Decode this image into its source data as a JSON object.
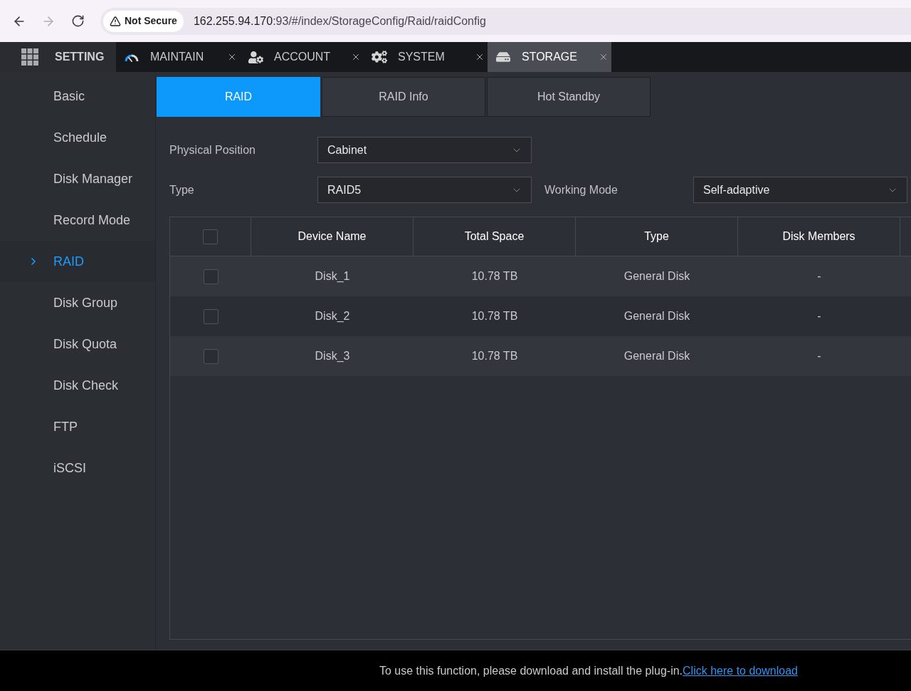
{
  "browser": {
    "back_disabled": false,
    "forward_disabled": true,
    "security_label": "Not Secure",
    "url_host": "162.255.94.170",
    "url_path": ":93/#/index/StorageConfig/Raid/raidConfig"
  },
  "app_menu": {
    "label": "SETTING"
  },
  "tabs": [
    {
      "label": "MAINTAIN",
      "selected": false
    },
    {
      "label": "ACCOUNT",
      "selected": false
    },
    {
      "label": "SYSTEM",
      "selected": false
    },
    {
      "label": "STORAGE",
      "selected": true
    }
  ],
  "sidebar": {
    "items": [
      {
        "label": "Basic",
        "selected": false
      },
      {
        "label": "Schedule",
        "selected": false
      },
      {
        "label": "Disk Manager",
        "selected": false
      },
      {
        "label": "Record Mode",
        "selected": false
      },
      {
        "label": "RAID",
        "selected": true
      },
      {
        "label": "Disk Group",
        "selected": false
      },
      {
        "label": "Disk Quota",
        "selected": false
      },
      {
        "label": "Disk Check",
        "selected": false
      },
      {
        "label": "FTP",
        "selected": false
      },
      {
        "label": "iSCSI",
        "selected": false
      }
    ]
  },
  "subtabs": [
    {
      "label": "RAID",
      "selected": true
    },
    {
      "label": "RAID Info",
      "selected": false
    },
    {
      "label": "Hot Standby",
      "selected": false
    }
  ],
  "form": {
    "rows": [
      [
        {
          "label": "Physical Position",
          "value": "Cabinet"
        }
      ],
      [
        {
          "label": "Type",
          "value": "RAID5"
        },
        {
          "label": "Working Mode",
          "value": "Self-adaptive"
        }
      ]
    ]
  },
  "table": {
    "select_all_checked": false,
    "columns": [
      "Device Name",
      "Total Space",
      "Type",
      "Disk Members"
    ],
    "rows": [
      {
        "checked": false,
        "cells": [
          "Disk_1",
          "10.78 TB",
          "General Disk",
          "-"
        ]
      },
      {
        "checked": false,
        "cells": [
          "Disk_2",
          "10.78 TB",
          "General Disk",
          "-"
        ]
      },
      {
        "checked": false,
        "cells": [
          "Disk_3",
          "10.78 TB",
          "General Disk",
          "-"
        ]
      }
    ]
  },
  "footer": {
    "message": "To use this function, please download and install the plug-in.",
    "link": "Click here to download"
  }
}
